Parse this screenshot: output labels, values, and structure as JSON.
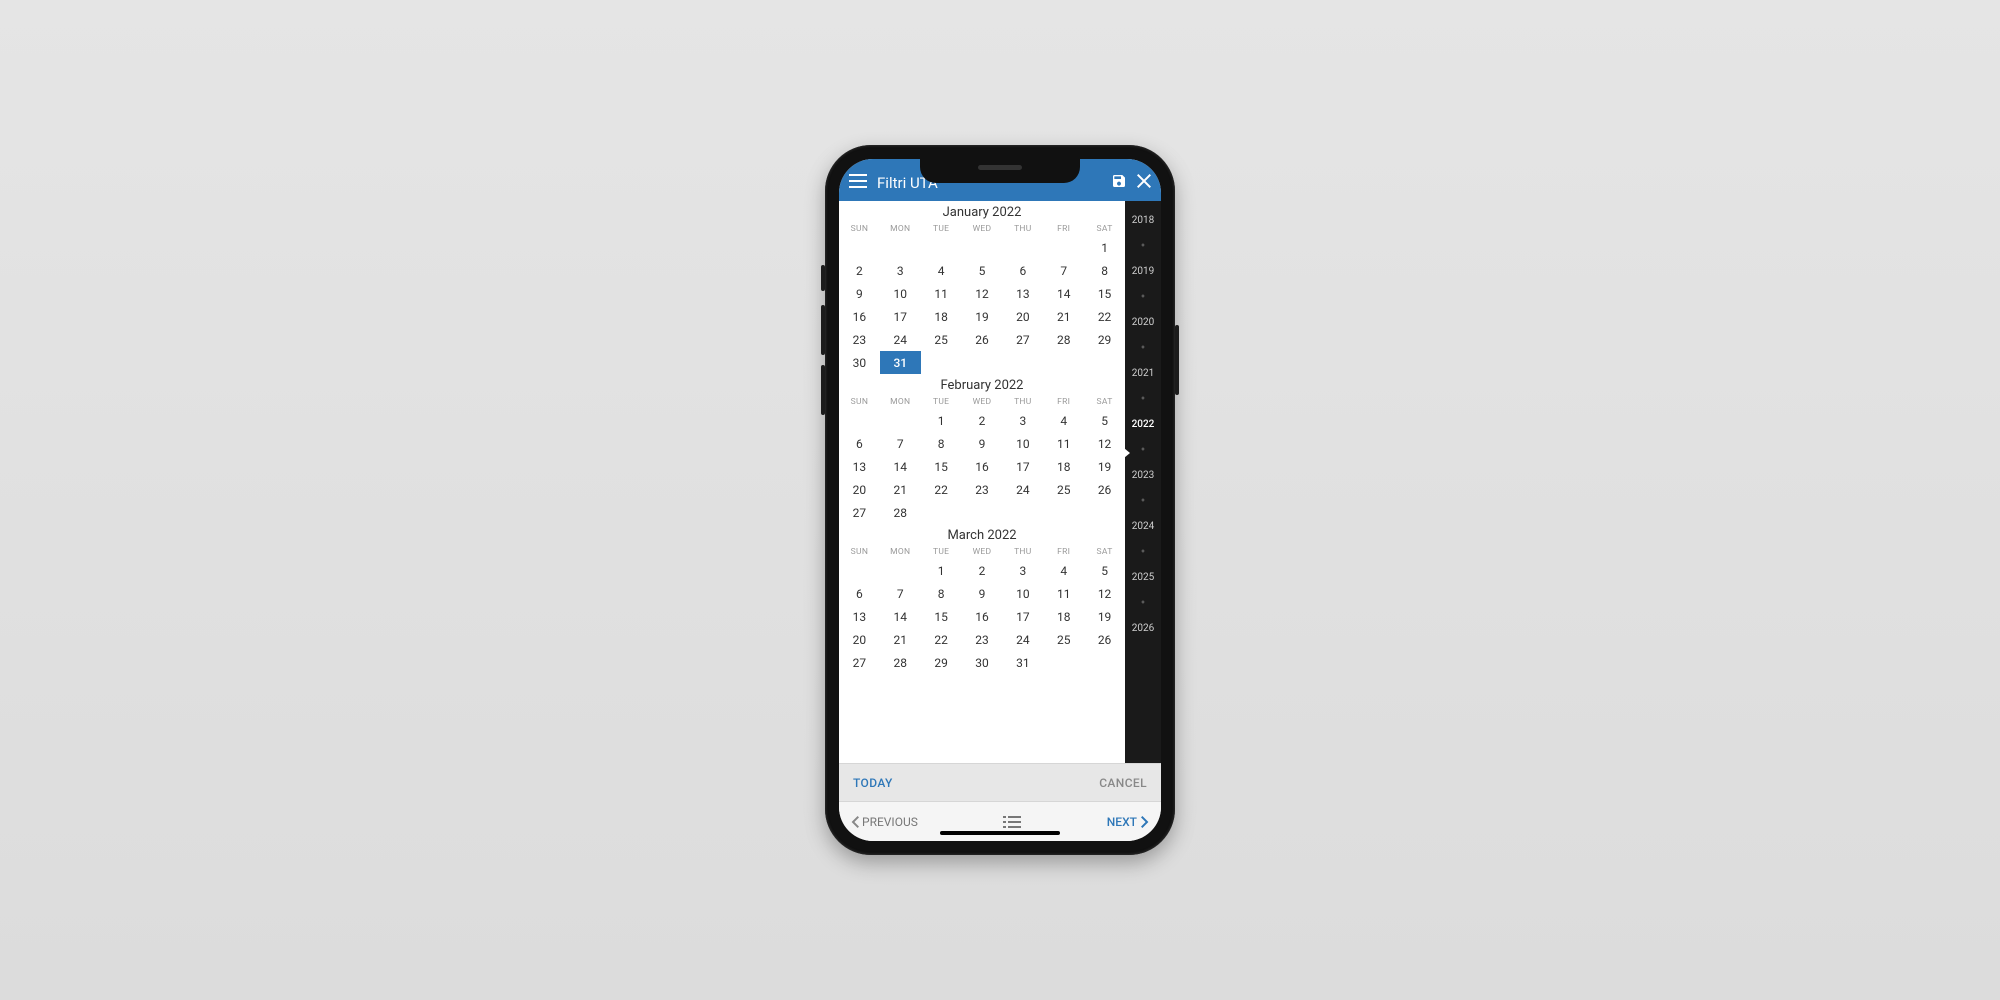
{
  "appbar": {
    "title": "Filtri UTA"
  },
  "calfooter": {
    "today": "TODAY",
    "cancel": "CANCEL"
  },
  "bottombar": {
    "previous": "PREVIOUS",
    "next": "NEXT"
  },
  "weekdays": [
    "SUN",
    "MON",
    "TUE",
    "WED",
    "THU",
    "FRI",
    "SAT"
  ],
  "months": [
    {
      "title": "January 2022",
      "startWeekday": 6,
      "days": 31,
      "selected": 31
    },
    {
      "title": "February 2022",
      "startWeekday": 2,
      "days": 28,
      "selected": null
    },
    {
      "title": "March 2022",
      "startWeekday": 2,
      "days": 31,
      "selected": null
    }
  ],
  "years": {
    "list": [
      2018,
      2019,
      2020,
      2021,
      2022,
      2023,
      2024,
      2025,
      2026
    ],
    "current": 2022
  }
}
